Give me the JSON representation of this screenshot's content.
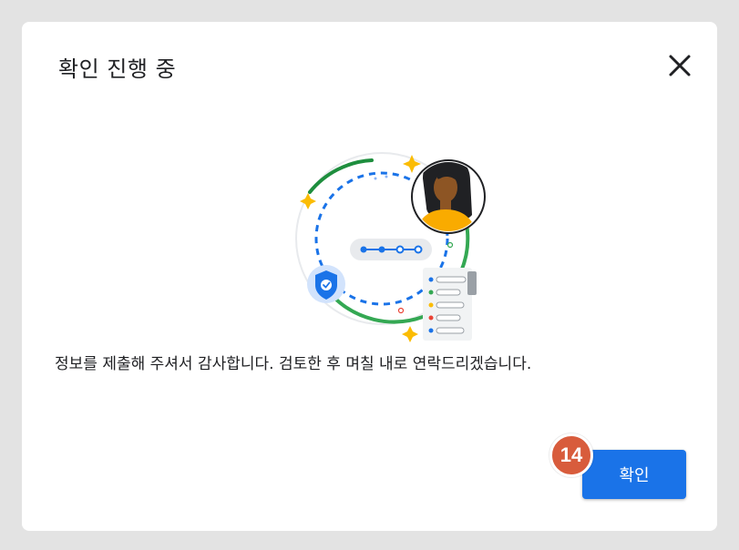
{
  "dialog": {
    "title": "확인 진행 중",
    "message": "정보를 제출해 주셔서 감사합니다. 검토한 후 며칠 내로 연락드리겠습니다.",
    "confirm_label": "확인",
    "step_badge": "14",
    "close_icon": "close-icon"
  },
  "colors": {
    "primary_button": "#1a73e8",
    "badge": "#d85c3c",
    "background": "#e3e3e3",
    "dialog": "#ffffff"
  }
}
